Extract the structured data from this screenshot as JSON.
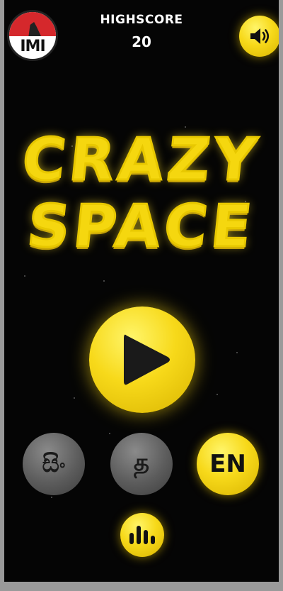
{
  "header": {
    "highscore_label": "HIGHSCORE",
    "highscore_value": "20",
    "logo_text": "IMI"
  },
  "title": {
    "line1": "CRAZY",
    "line2": "SPACE"
  },
  "buttons": {
    "sound_icon": "speaker-icon",
    "play_icon": "play-icon",
    "leaderboard_icon": "leaderboard-icon"
  },
  "languages": [
    {
      "label": "සිං",
      "selected": false
    },
    {
      "label": "த",
      "selected": false
    },
    {
      "label": "EN",
      "selected": true
    }
  ],
  "colors": {
    "background": "#050505",
    "accent_yellow": "#f7d91a",
    "inactive_gray": "#5c5c5c"
  }
}
